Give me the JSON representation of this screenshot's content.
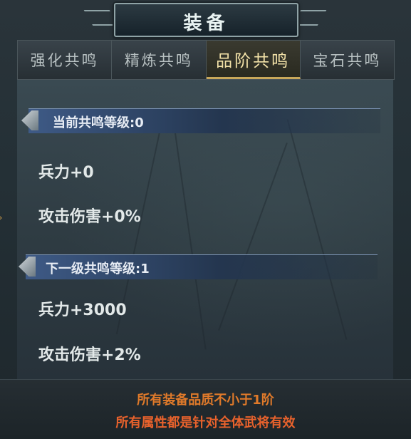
{
  "window": {
    "title": "装备"
  },
  "tabs": [
    {
      "label": "强化共鸣",
      "active": false
    },
    {
      "label": "精炼共鸣",
      "active": false
    },
    {
      "label": "品阶共鸣",
      "active": true
    },
    {
      "label": "宝石共鸣",
      "active": false
    }
  ],
  "current": {
    "header": "当前共鸣等级:0",
    "stats": [
      "兵力+0",
      "攻击伤害+0%"
    ]
  },
  "next": {
    "header": "下一级共鸣等级:1",
    "stats": [
      "兵力+3000",
      "攻击伤害+2%"
    ]
  },
  "footer": {
    "condition": "所有装备品质不小于1阶",
    "note": "所有属性都是针对全体武将有效"
  },
  "colors": {
    "active_tab_text": "#f3e2a8",
    "condition_text": "#e07a2a",
    "note_text": "#e8622c",
    "header_bg": "#3e5a86"
  }
}
